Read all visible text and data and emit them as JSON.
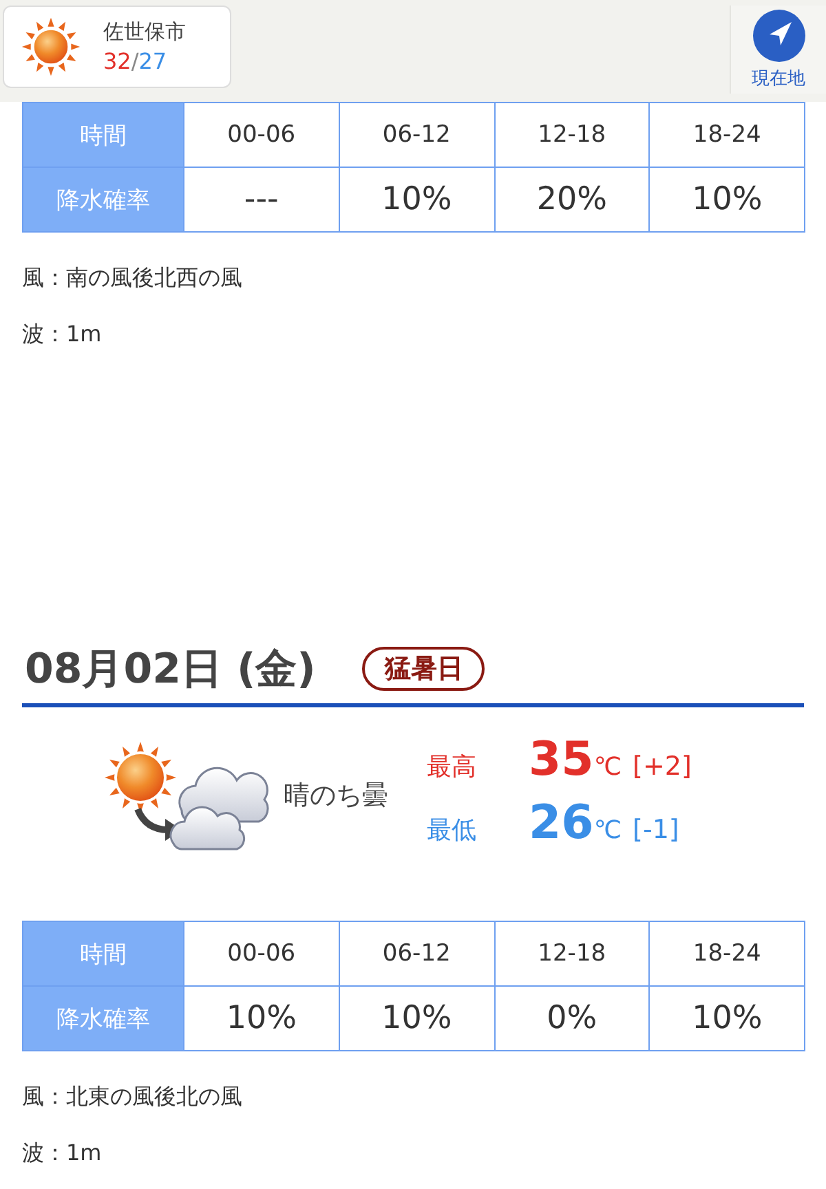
{
  "header": {
    "city": "佐世保市",
    "high": "32",
    "separator": "/",
    "low": "27",
    "location_button": "現在地"
  },
  "sections": [
    {
      "table": {
        "time_label": "時間",
        "precip_label": "降水確率",
        "times": [
          "00-06",
          "06-12",
          "12-18",
          "18-24"
        ],
        "precip": [
          "---",
          "10%",
          "20%",
          "10%"
        ]
      },
      "wind": "風：南の風後北西の風",
      "wave": "波：1m"
    },
    {
      "date": "08月02日 (金)",
      "badge": "猛暑日",
      "forecast": {
        "weather": "晴のち曇",
        "high_label": "最高",
        "high": "35",
        "high_unit": "℃",
        "high_diff": "[+2]",
        "low_label": "最低",
        "low": "26",
        "low_unit": "℃",
        "low_diff": "[-1]"
      },
      "table": {
        "time_label": "時間",
        "precip_label": "降水確率",
        "times": [
          "00-06",
          "06-12",
          "12-18",
          "18-24"
        ],
        "precip": [
          "10%",
          "10%",
          "0%",
          "10%"
        ]
      },
      "wind": "風：北東の風後北の風",
      "wave": "波：1m"
    }
  ]
}
